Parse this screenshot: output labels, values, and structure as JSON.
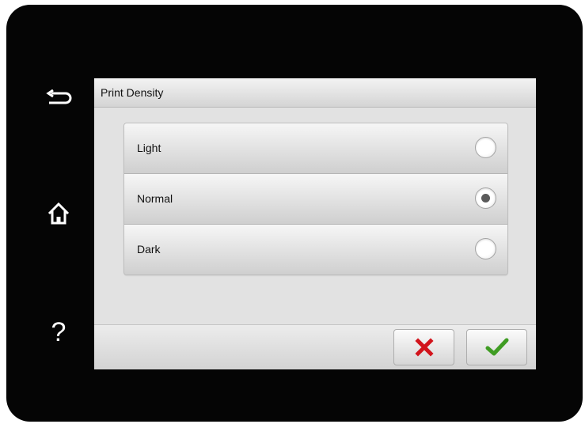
{
  "screen": {
    "title": "Print Density"
  },
  "side_buttons": [
    {
      "icon": "back-arrow-icon"
    },
    {
      "icon": "home-icon"
    },
    {
      "icon": "help-icon",
      "glyph": "?"
    }
  ],
  "options": [
    {
      "label": "Light",
      "selected": false
    },
    {
      "label": "Normal",
      "selected": true
    },
    {
      "label": "Dark",
      "selected": false
    }
  ],
  "actions": {
    "cancel": {
      "icon": "red-x-icon",
      "color": "#d2141c"
    },
    "confirm": {
      "icon": "green-check-icon",
      "color": "#3f9c23"
    }
  }
}
